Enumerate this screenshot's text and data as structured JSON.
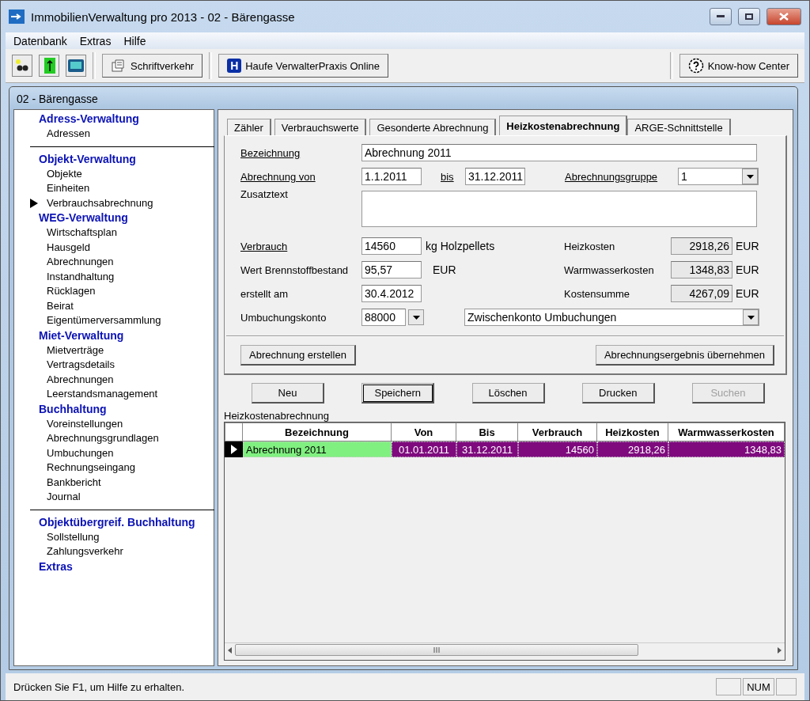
{
  "window": {
    "title": "ImmobilienVerwaltung pro 2013 - 02 - Bärengasse"
  },
  "menu": [
    "Datenbank",
    "Extras",
    "Hilfe"
  ],
  "toolbar": [
    {
      "kind": "letter",
      "label": "Schriftverkehr"
    },
    {
      "kind": "badge",
      "badge": "H",
      "label": "Haufe VerwalterPraxis Online"
    },
    {
      "kind": "help",
      "label": "Know-how Center"
    }
  ],
  "child_window": {
    "title": "02 - Bärengasse"
  },
  "sidebar": [
    {
      "title": "Adress-Verwaltung",
      "divider": true,
      "items": [
        {
          "label": "Adressen",
          "selected": false
        }
      ]
    },
    {
      "title": "Objekt-Verwaltung",
      "divider": false,
      "items": [
        {
          "label": "Objekte",
          "selected": false
        },
        {
          "label": "Einheiten",
          "selected": false
        },
        {
          "label": "Verbrauchsabrechnung",
          "selected": true
        }
      ]
    },
    {
      "title": "WEG-Verwaltung",
      "divider": false,
      "items": [
        {
          "label": "Wirtschaftsplan",
          "selected": false
        },
        {
          "label": "Hausgeld",
          "selected": false
        },
        {
          "label": "Abrechnungen",
          "selected": false
        },
        {
          "label": "Instandhaltung",
          "selected": false
        },
        {
          "label": "Rücklagen",
          "selected": false
        },
        {
          "label": "Beirat",
          "selected": false
        },
        {
          "label": "Eigentümerversammlung",
          "selected": false
        }
      ]
    },
    {
      "title": "Miet-Verwaltung",
      "divider": false,
      "items": [
        {
          "label": "Mietverträge",
          "selected": false
        },
        {
          "label": "Vertragsdetails",
          "selected": false
        },
        {
          "label": "Abrechnungen",
          "selected": false
        },
        {
          "label": "Leerstandsmanagement",
          "selected": false
        }
      ]
    },
    {
      "title": "Buchhaltung",
      "divider": true,
      "items": [
        {
          "label": "Voreinstellungen",
          "selected": false
        },
        {
          "label": "Abrechnungsgrundlagen",
          "selected": false
        },
        {
          "label": "Umbuchungen",
          "selected": false
        },
        {
          "label": "Rechnungseingang",
          "selected": false
        },
        {
          "label": "Bankbericht",
          "selected": false
        },
        {
          "label": "Journal",
          "selected": false
        }
      ]
    },
    {
      "title": "Objektübergreif. Buchhaltung",
      "divider": false,
      "items": [
        {
          "label": "Sollstellung",
          "selected": false
        },
        {
          "label": "Zahlungsverkehr",
          "selected": false
        }
      ]
    },
    {
      "title": "Extras",
      "divider": false
    }
  ],
  "tabs": [
    {
      "label": "Zähler",
      "selected": false
    },
    {
      "label": "Verbrauchswerte",
      "selected": false
    },
    {
      "label": "Gesonderte Abrechnung",
      "selected": false
    },
    {
      "label": "Heizkostenabrechnung",
      "selected": true
    },
    {
      "label": "ARGE-Schnittstelle",
      "selected": false
    }
  ],
  "form": {
    "bezeichnung": {
      "label": "Bezeichnung",
      "underlined": true,
      "value": "Abrechnung 2011"
    },
    "von": {
      "label": "Abrechnung von",
      "underlined": true,
      "value": "1.1.2011"
    },
    "bis": {
      "label": "bis",
      "underlined": true,
      "value": "31.12.2011"
    },
    "gruppe": {
      "label": "Abrechnungsgruppe",
      "underlined": true,
      "value": "1"
    },
    "zusatztext": {
      "label": "Zusatztext",
      "underlined": false
    },
    "verbrauch": {
      "label": "Verbrauch",
      "underlined": true,
      "value": "14560",
      "unit": "kg Holzpellets"
    },
    "brennstoff": {
      "label": "Wert Brennstoffbestand",
      "underlined": false,
      "value": "95,57",
      "unit": "EUR"
    },
    "erstellt": {
      "label": "erstellt am",
      "underlined": false,
      "value": "30.4.2012"
    },
    "konto": {
      "label": "Umbuchungskonto",
      "underlined": false,
      "value": "88000",
      "name": "Zwischenkonto Umbuchungen"
    },
    "totals": [
      {
        "label": "Heizkosten",
        "value": "2918,26",
        "unit": "EUR"
      },
      {
        "label": "Warmwasserkosten",
        "value": "1348,83",
        "unit": "EUR"
      },
      {
        "label": "Kostensumme",
        "value": "4267,09",
        "unit": "EUR"
      }
    ],
    "buttons": [
      "Abrechnung erstellen",
      "Abrechnungsergebnis übernehmen"
    ]
  },
  "actions": [
    {
      "label": "Neu",
      "default": false,
      "disabled": false
    },
    {
      "label": "Speichern",
      "default": true,
      "disabled": false
    },
    {
      "label": "Löschen",
      "default": false,
      "disabled": false
    },
    {
      "label": "Drucken",
      "default": false,
      "disabled": false
    },
    {
      "label": "Suchen",
      "default": false,
      "disabled": true
    }
  ],
  "grid": {
    "title": "Heizkostenabrechnung",
    "columns": [
      "Bezeichnung",
      "Von",
      "Bis",
      "Verbrauch",
      "Heizkosten",
      "Warmwasserkosten"
    ],
    "rows": [
      {
        "selected": true,
        "cells": [
          "Abrechnung 2011",
          "01.01.2011",
          "31.12.2011",
          "14560",
          "2918,26",
          "1348,83"
        ]
      }
    ]
  },
  "status_bar": {
    "text": "Drücken Sie F1, um Hilfe zu erhalten.",
    "indicators": [
      "NUM"
    ]
  }
}
